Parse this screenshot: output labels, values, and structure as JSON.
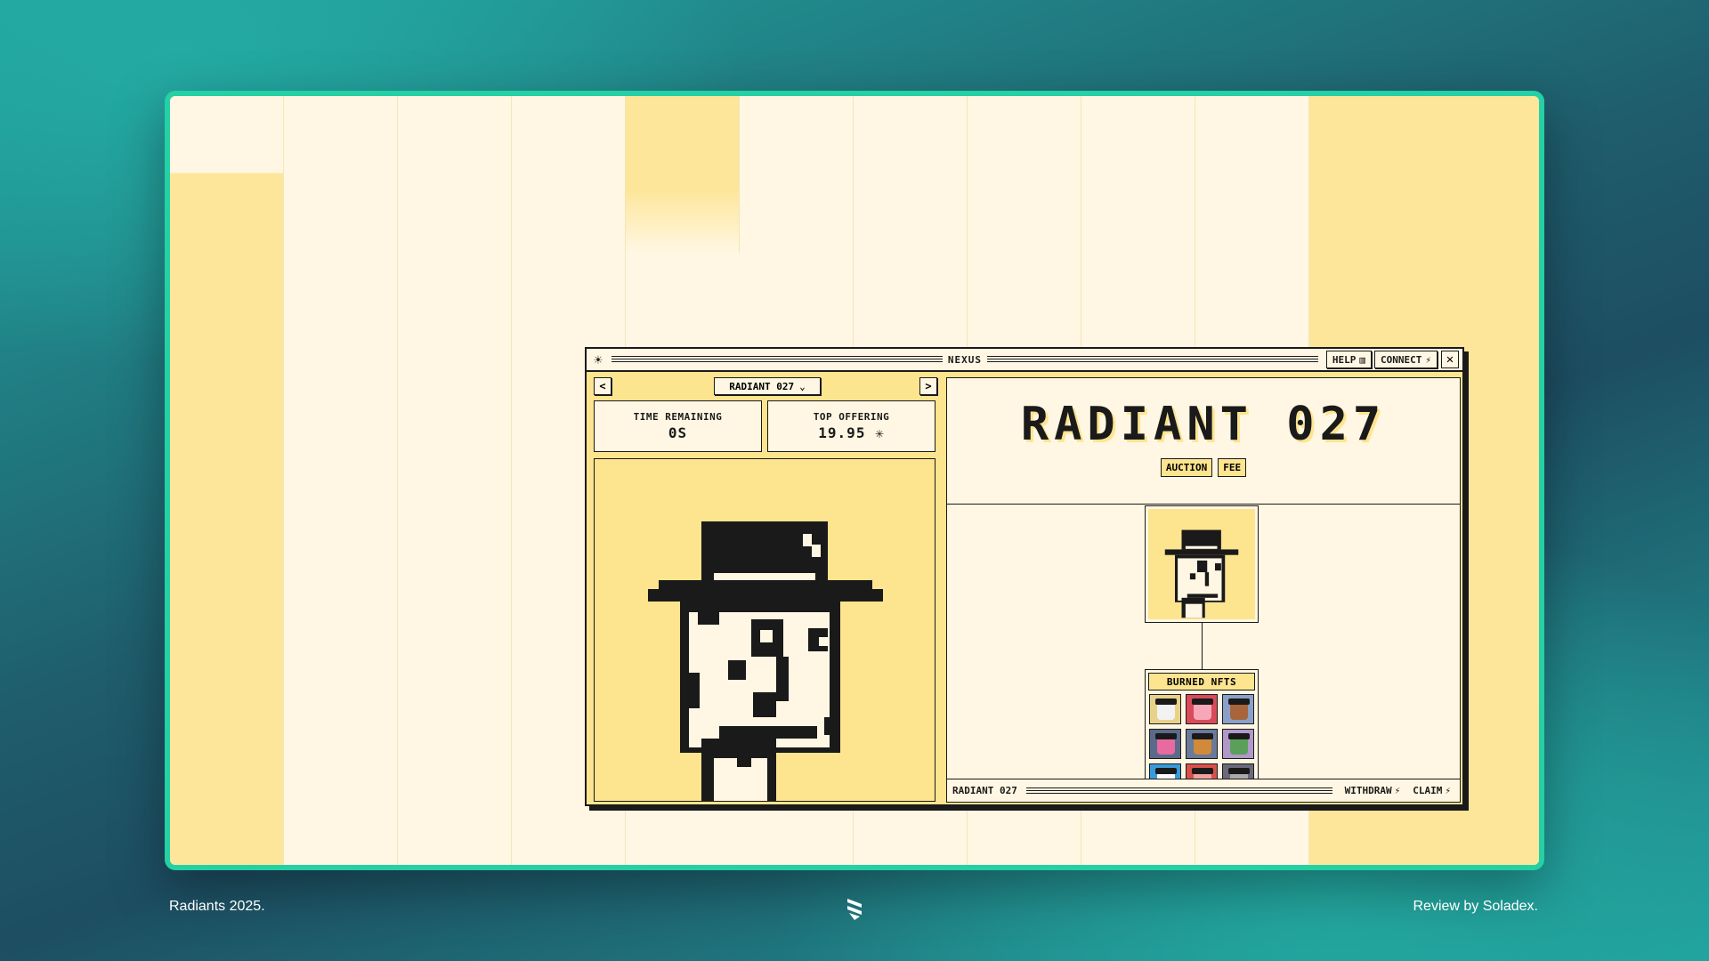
{
  "window": {
    "title": "NEXUS",
    "help_label": "HELP",
    "connect_label": "CONNECT",
    "close_label": "✕"
  },
  "nav": {
    "prev": "<",
    "next": ">",
    "selected": "RADIANT 027",
    "chevron": "⌄"
  },
  "stats": {
    "time_remaining_label": "TIME REMAINING",
    "time_remaining_value": "0S",
    "top_offering_label": "TOP OFFERING",
    "top_offering_value": "19.95 ✳"
  },
  "hero": {
    "title": "RADIANT 027",
    "tags": [
      "AUCTION",
      "FEE"
    ]
  },
  "burned": {
    "label": "BURNED NFTS",
    "items": [
      {
        "bg": "#e8d28a",
        "face": "#f2f2f2"
      },
      {
        "bg": "#d94a5a",
        "face": "#f7a8b8"
      },
      {
        "bg": "#8aa0c8",
        "face": "#a8643a"
      },
      {
        "bg": "#5a6a8a",
        "face": "#e86aa0"
      },
      {
        "bg": "#6a7a9a",
        "face": "#d08a3a"
      },
      {
        "bg": "#b098c8",
        "face": "#5aa05a"
      },
      {
        "bg": "#3a9ad8",
        "face": "#ffffff"
      },
      {
        "bg": "#d8504a",
        "face": "#f0a0a0"
      },
      {
        "bg": "#6a6a7a",
        "face": "#aaaaaa"
      }
    ]
  },
  "footer": {
    "name": "RADIANT 027",
    "withdraw_label": "WITHDRAW",
    "claim_label": "CLAIM"
  },
  "captions": {
    "left": "Radiants 2025.",
    "right": "Review by Soladex."
  },
  "colors": {
    "accent": "#25d0a5",
    "yellow": "#fde48f",
    "cream": "#fff7e3",
    "ink": "#1a1a1a"
  }
}
